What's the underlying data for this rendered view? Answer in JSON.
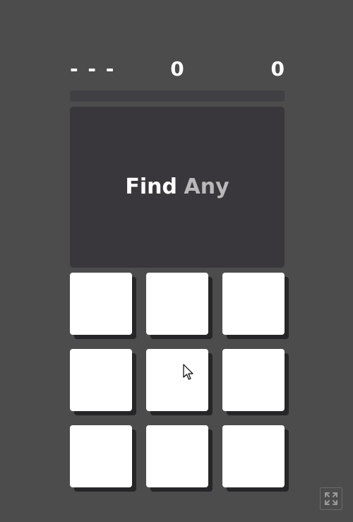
{
  "scoreboard": {
    "left": "- - -",
    "middle": "0",
    "right": "0"
  },
  "progress": {
    "fraction": 0
  },
  "prompt": {
    "verb": "Find",
    "target": "Any"
  },
  "grid": {
    "rows": 3,
    "cols": 3,
    "tiles": [
      "",
      "",
      "",
      "",
      "",
      "",
      "",
      "",
      ""
    ]
  },
  "controls": {
    "fullscreen_icon": "expand-icon"
  },
  "colors": {
    "background": "#4c4c4c",
    "panel": "#39373b",
    "tile": "#ffffff",
    "tile_shadow": "#262528",
    "prompt_verb": "#ffffff",
    "prompt_target": "#b9b9b9"
  }
}
